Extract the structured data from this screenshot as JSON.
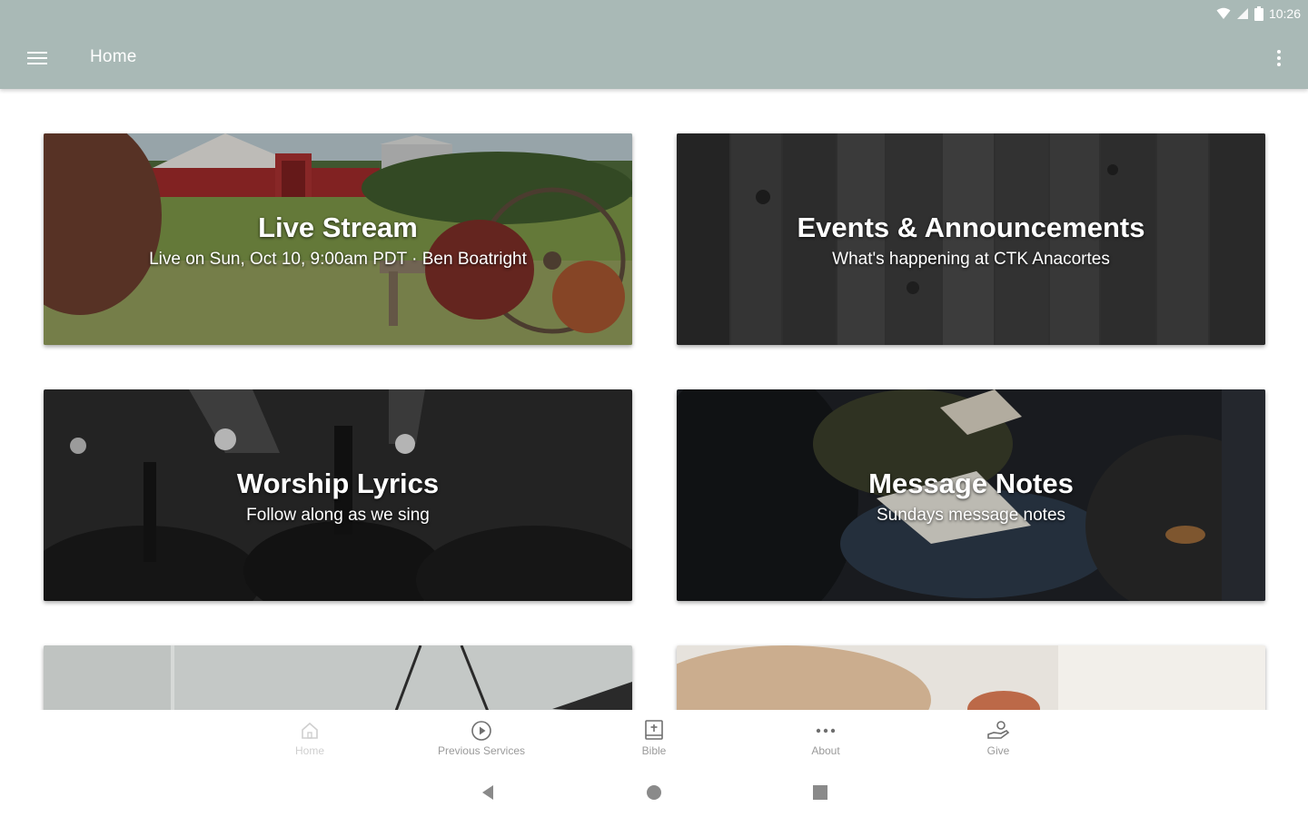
{
  "status_bar": {
    "time": "10:26"
  },
  "app_bar": {
    "title": "Home"
  },
  "cards": [
    {
      "title": "Live Stream",
      "subtitle": "Live on Sun, Oct 10, 9:00am PDT · Ben Boatright"
    },
    {
      "title": "Events & Announcements",
      "subtitle": "What's happening at CTK Anacortes"
    },
    {
      "title": "Worship Lyrics",
      "subtitle": "Follow along as we sing"
    },
    {
      "title": "Message Notes",
      "subtitle": "Sundays message notes"
    }
  ],
  "bottom_nav": [
    {
      "label": "Home",
      "icon": "home-icon",
      "active": true
    },
    {
      "label": "Previous Services",
      "icon": "play-circle-icon"
    },
    {
      "label": "Bible",
      "icon": "bible-icon"
    },
    {
      "label": "About",
      "icon": "more-horizontal-icon"
    },
    {
      "label": "Give",
      "icon": "give-hand-icon"
    }
  ],
  "colors": {
    "app_bar": "#a9b9b6",
    "nav_label": "#9a9a9a",
    "nav_label_active": "#cfcfcf"
  }
}
